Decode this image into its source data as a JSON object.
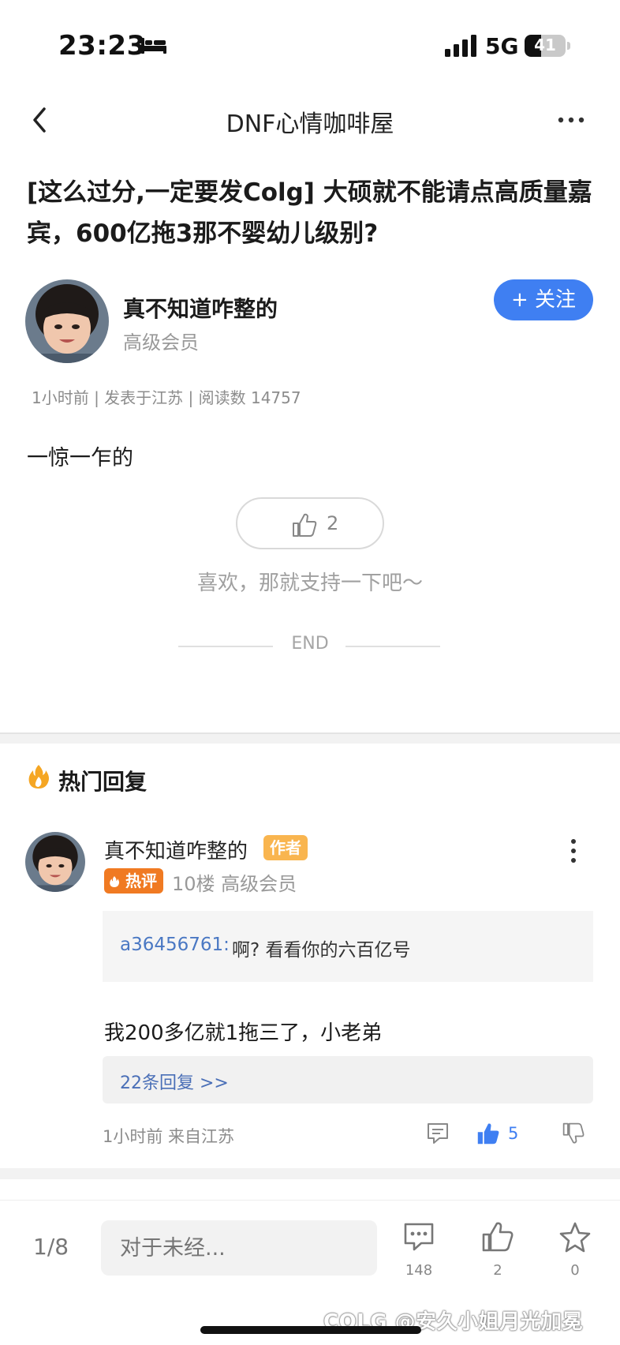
{
  "status_bar": {
    "time": "23:23",
    "network": "5G",
    "battery": "41",
    "battery_level": 0.41
  },
  "nav": {
    "title": "DNF心情咖啡屋"
  },
  "post": {
    "title": "[这么过分,一定要发Colg] 大硕就不能请点高质量嘉宾，600亿拖3那不婴幼儿级别?",
    "author": {
      "name": "真不知道咋整的",
      "level": "高级会员"
    },
    "follow_label": "+ 关注",
    "meta": "1小时前 | 发表于江苏 | 阅读数 14757",
    "body": "一惊一乍的",
    "likes": "2",
    "support_text": "喜欢，那就支持一下吧～",
    "end_text": "END"
  },
  "hot_replies": {
    "title": "热门回复",
    "items": [
      {
        "author": "真不知道咋整的",
        "author_badge": "作者",
        "hot_badge": "热评",
        "floor_level": "10楼 高级会员",
        "quote_user": "a36456761:",
        "quote_text": "啊? 看看你的六百亿号",
        "text": "我200多亿就1拖三了，小老弟",
        "subreplies": "22条回复 >>",
        "time": "1小时前 来自江苏",
        "likes": "5"
      }
    ]
  },
  "bottom_bar": {
    "page": "1/8",
    "input_placeholder": "对于未经...",
    "comments": "148",
    "likes": "2",
    "favorites": "0"
  },
  "watermark": "COLG @安久小姐月光加冕",
  "colors": {
    "accent": "#3f7ff2",
    "hot": "#f07a22",
    "author_badge": "#f9b54f"
  }
}
